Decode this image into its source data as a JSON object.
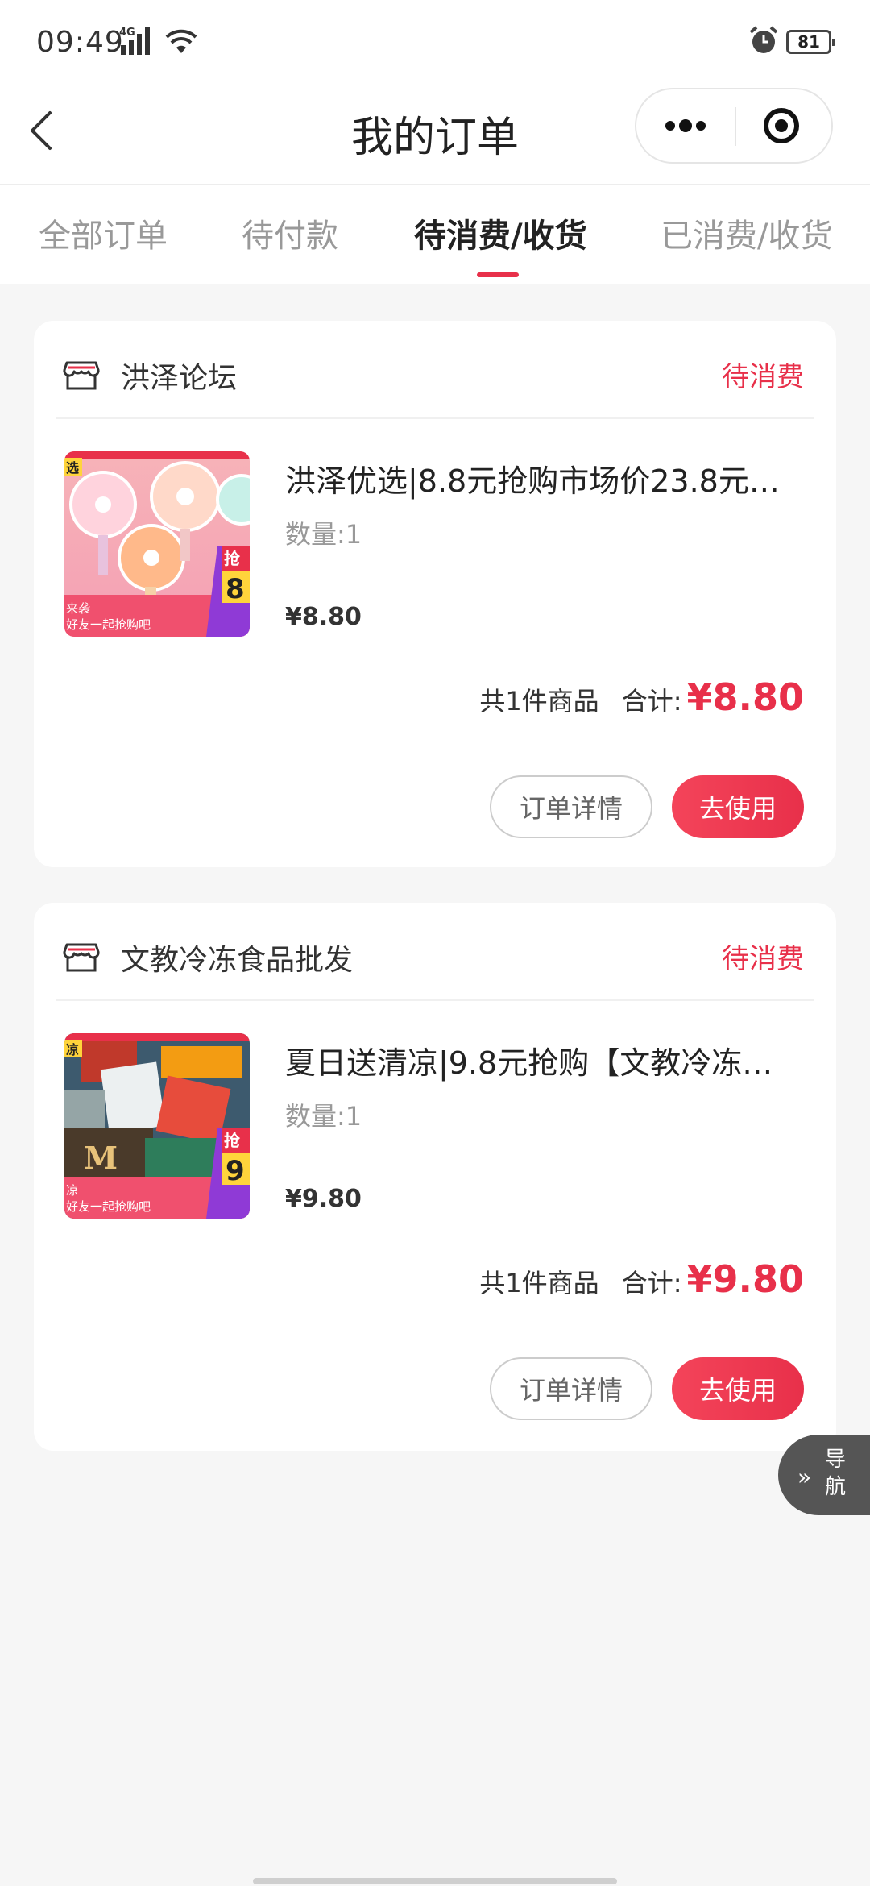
{
  "status_bar": {
    "time": "09:49",
    "network": "4G",
    "battery": "81"
  },
  "header": {
    "title": "我的订单"
  },
  "tabs": [
    {
      "label": "全部订单",
      "active": false
    },
    {
      "label": "待付款",
      "active": false
    },
    {
      "label": "待消费/收货",
      "active": true
    },
    {
      "label": "已消费/收货",
      "active": false
    }
  ],
  "orders": [
    {
      "shop": "洪泽论坛",
      "status": "待消费",
      "product_title": "洪泽优选|8.8元抢购市场价23.8元…",
      "quantity": "数量:1",
      "price": "¥8.80",
      "count_text": "共1件商品",
      "total_label": "合计:",
      "total": "¥8.80",
      "detail_label": "订单详情",
      "use_label": "去使用",
      "thumb": {
        "tag": "选",
        "badge": "抢",
        "digit": "8",
        "line1": "来袭",
        "line2": "好友一起抢购吧"
      }
    },
    {
      "shop": "文教冷冻食品批发",
      "status": "待消费",
      "product_title": "夏日送清凉|9.8元抢购【文教冷冻…",
      "quantity": "数量:1",
      "price": "¥9.80",
      "count_text": "共1件商品",
      "total_label": "合计:",
      "total": "¥9.80",
      "detail_label": "订单详情",
      "use_label": "去使用",
      "thumb": {
        "tag": "凉",
        "badge": "抢",
        "digit": "9",
        "line1": "凉",
        "line2": "好友一起抢购吧"
      }
    }
  ],
  "float_nav": {
    "label": "导航",
    "arrow": "»"
  },
  "colors": {
    "accent": "#e8304a",
    "background": "#f6f6f6"
  }
}
